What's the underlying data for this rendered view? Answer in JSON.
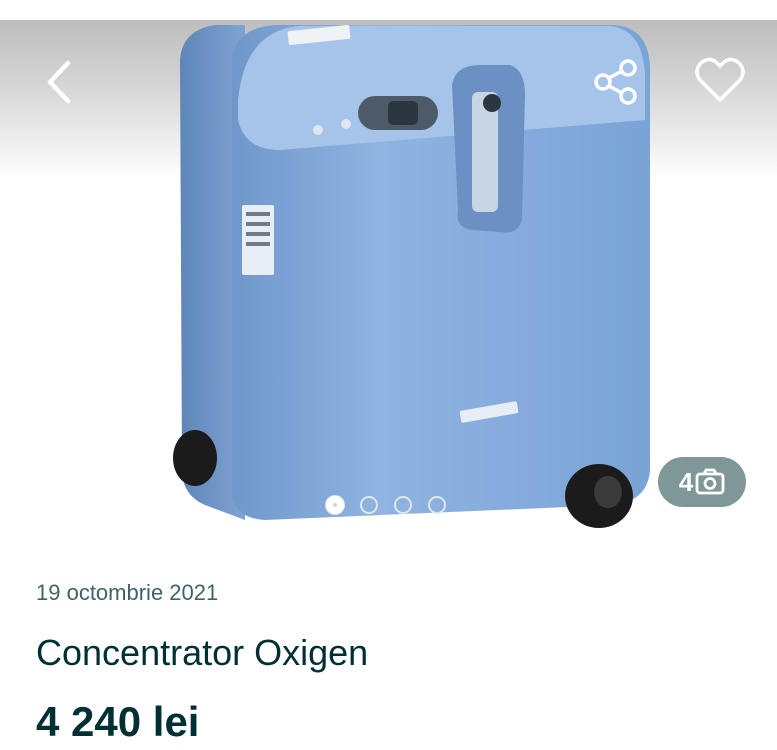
{
  "gallery": {
    "photo_count": "4",
    "total_photos": 4,
    "active_index": 0,
    "photo_description_icon": "oxygen-concentrator-photo"
  },
  "toolbar": {
    "back_icon": "chevron-left-icon",
    "share_icon": "share-icon",
    "favorite_icon": "heart-icon"
  },
  "listing": {
    "date": "19 octombrie 2021",
    "title": "Concentrator Oxigen",
    "price": "4 240 lei"
  },
  "colors": {
    "text_primary": "#002f34",
    "text_secondary": "#406367",
    "badge_bg": "#7f9796",
    "device_blue": "#8fb4e0"
  }
}
